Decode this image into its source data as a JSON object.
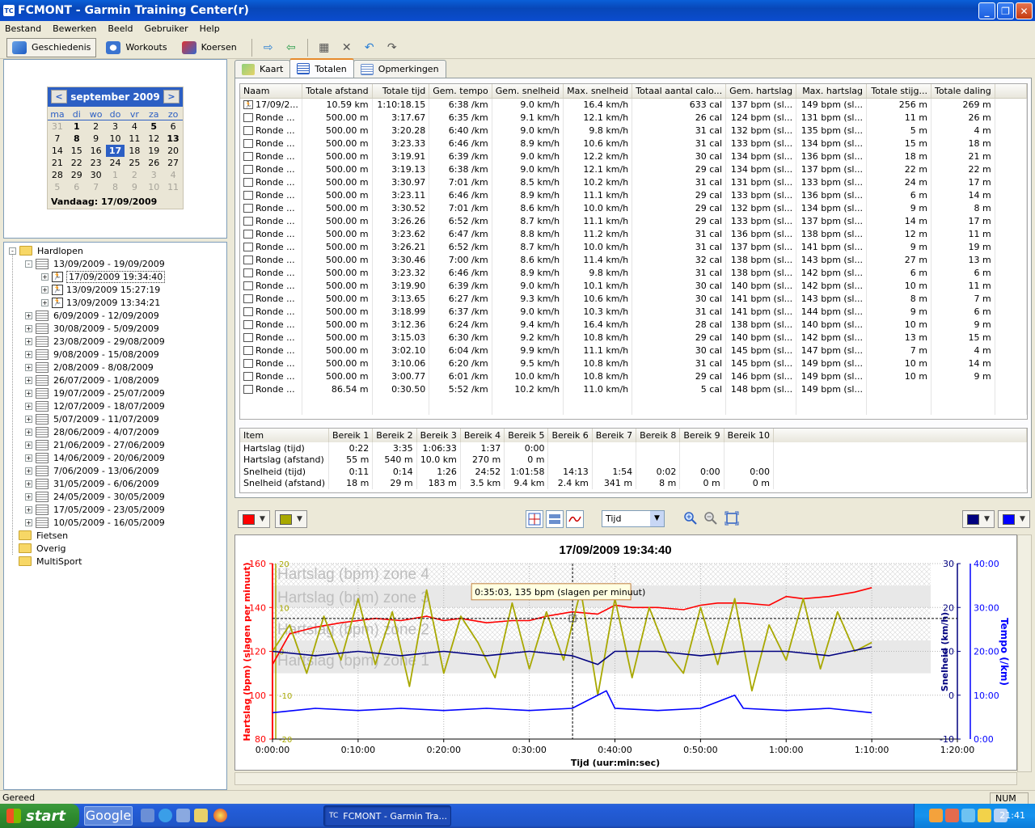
{
  "window": {
    "title": "FCMONT - Garmin Training Center(r)",
    "app_icon": "tc-icon"
  },
  "menu": [
    "Bestand",
    "Bewerken",
    "Beeld",
    "Gebruiker",
    "Help"
  ],
  "toolbar": {
    "geschiedenis": "Geschiedenis",
    "workouts": "Workouts",
    "koersen": "Koersen"
  },
  "calendar": {
    "month": "september 2009",
    "prev": "<",
    "next": ">",
    "dow": [
      "ma",
      "di",
      "wo",
      "do",
      "vr",
      "za",
      "zo"
    ],
    "weeks": [
      [
        {
          "d": "31",
          "o": 1
        },
        {
          "d": "1",
          "b": 1
        },
        {
          "d": "2"
        },
        {
          "d": "3"
        },
        {
          "d": "5",
          "b": 1,
          "_note": "placeholder"
        },
        {
          "d": "5",
          "b": 1
        },
        {
          "d": "6"
        }
      ],
      [
        {
          "d": "7"
        },
        {
          "d": "8",
          "b": 1
        },
        {
          "d": "9"
        },
        {
          "d": "10"
        },
        {
          "d": "11"
        },
        {
          "d": "12"
        },
        {
          "d": "13",
          "b": 1
        }
      ],
      [
        {
          "d": "14"
        },
        {
          "d": "15"
        },
        {
          "d": "16"
        },
        {
          "d": "17",
          "s": 1
        },
        {
          "d": "18"
        },
        {
          "d": "19"
        },
        {
          "d": "20"
        }
      ],
      [
        {
          "d": "21"
        },
        {
          "d": "22"
        },
        {
          "d": "23"
        },
        {
          "d": "24"
        },
        {
          "d": "25"
        },
        {
          "d": "26"
        },
        {
          "d": "27"
        }
      ],
      [
        {
          "d": "28"
        },
        {
          "d": "29"
        },
        {
          "d": "30"
        },
        {
          "d": "1",
          "o": 1
        },
        {
          "d": "2",
          "o": 1
        },
        {
          "d": "3",
          "o": 1
        },
        {
          "d": "4",
          "o": 1
        }
      ],
      [
        {
          "d": "5",
          "o": 1
        },
        {
          "d": "6",
          "o": 1
        },
        {
          "d": "7",
          "o": 1
        },
        {
          "d": "8",
          "o": 1
        },
        {
          "d": "9",
          "o": 1
        },
        {
          "d": "10",
          "o": 1
        },
        {
          "d": "11",
          "o": 1
        }
      ]
    ],
    "today": "Vandaag: 17/09/2009"
  },
  "tree": {
    "root": "Hardlopen",
    "week_open": "13/09/2009 - 19/09/2009",
    "activities": [
      "17/09/2009 19:34:40",
      "13/09/2009 15:27:19",
      "13/09/2009 13:34:21"
    ],
    "weeks": [
      "6/09/2009 - 12/09/2009",
      "30/08/2009 - 5/09/2009",
      "23/08/2009 - 29/08/2009",
      "9/08/2009 - 15/08/2009",
      "2/08/2009 - 8/08/2009",
      "26/07/2009 - 1/08/2009",
      "19/07/2009 - 25/07/2009",
      "12/07/2009 - 18/07/2009",
      "5/07/2009 - 11/07/2009",
      "28/06/2009 - 4/07/2009",
      "21/06/2009 - 27/06/2009",
      "14/06/2009 - 20/06/2009",
      "7/06/2009 - 13/06/2009",
      "31/05/2009 - 6/06/2009",
      "24/05/2009 - 30/05/2009",
      "17/05/2009 - 23/05/2009",
      "10/05/2009 - 16/05/2009"
    ],
    "folders": [
      "Fietsen",
      "Overig",
      "MultiSport"
    ]
  },
  "tabs": [
    "Kaart",
    "Totalen",
    "Opmerkingen"
  ],
  "laps": {
    "headers": [
      "Naam",
      "Totale afstand",
      "Totale tijd",
      "Gem. tempo",
      "Gem. snelheid",
      "Max. snelheid",
      "Totaal aantal calo...",
      "Gem. hartslag",
      "Max. hartslag",
      "Totale stijg...",
      "Totale daling"
    ],
    "rows": [
      [
        "17/09/2...",
        "10.59 km",
        "1:10:18.15",
        "6:38 /km",
        "9.0 km/h",
        "16.4 km/h",
        "633 cal",
        "137 bpm (sl...",
        "149 bpm (sl...",
        "256 m",
        "269 m"
      ],
      [
        "Ronde ...",
        "500.00 m",
        "3:17.67",
        "6:35 /km",
        "9.1 km/h",
        "12.1 km/h",
        "26 cal",
        "124 bpm (sl...",
        "131 bpm (sl...",
        "11 m",
        "26 m"
      ],
      [
        "Ronde ...",
        "500.00 m",
        "3:20.28",
        "6:40 /km",
        "9.0 km/h",
        "9.8 km/h",
        "31 cal",
        "132 bpm (sl...",
        "135 bpm (sl...",
        "5 m",
        "4 m"
      ],
      [
        "Ronde ...",
        "500.00 m",
        "3:23.33",
        "6:46 /km",
        "8.9 km/h",
        "10.6 km/h",
        "31 cal",
        "133 bpm (sl...",
        "134 bpm (sl...",
        "15 m",
        "18 m"
      ],
      [
        "Ronde ...",
        "500.00 m",
        "3:19.91",
        "6:39 /km",
        "9.0 km/h",
        "12.2 km/h",
        "30 cal",
        "134 bpm (sl...",
        "136 bpm (sl...",
        "18 m",
        "21 m"
      ],
      [
        "Ronde ...",
        "500.00 m",
        "3:19.13",
        "6:38 /km",
        "9.0 km/h",
        "12.1 km/h",
        "29 cal",
        "134 bpm (sl...",
        "137 bpm (sl...",
        "22 m",
        "22 m"
      ],
      [
        "Ronde ...",
        "500.00 m",
        "3:30.97",
        "7:01 /km",
        "8.5 km/h",
        "10.2 km/h",
        "31 cal",
        "131 bpm (sl...",
        "133 bpm (sl...",
        "24 m",
        "17 m"
      ],
      [
        "Ronde ...",
        "500.00 m",
        "3:23.11",
        "6:46 /km",
        "8.9 km/h",
        "11.1 km/h",
        "29 cal",
        "133 bpm (sl...",
        "136 bpm (sl...",
        "6 m",
        "14 m"
      ],
      [
        "Ronde ...",
        "500.00 m",
        "3:30.52",
        "7:01 /km",
        "8.6 km/h",
        "10.0 km/h",
        "29 cal",
        "132 bpm (sl...",
        "134 bpm (sl...",
        "9 m",
        "8 m"
      ],
      [
        "Ronde ...",
        "500.00 m",
        "3:26.26",
        "6:52 /km",
        "8.7 km/h",
        "11.1 km/h",
        "29 cal",
        "133 bpm (sl...",
        "137 bpm (sl...",
        "14 m",
        "17 m"
      ],
      [
        "Ronde ...",
        "500.00 m",
        "3:23.62",
        "6:47 /km",
        "8.8 km/h",
        "11.2 km/h",
        "31 cal",
        "136 bpm (sl...",
        "138 bpm (sl...",
        "12 m",
        "11 m"
      ],
      [
        "Ronde ...",
        "500.00 m",
        "3:26.21",
        "6:52 /km",
        "8.7 km/h",
        "10.0 km/h",
        "31 cal",
        "137 bpm (sl...",
        "141 bpm (sl...",
        "9 m",
        "19 m"
      ],
      [
        "Ronde ...",
        "500.00 m",
        "3:30.46",
        "7:00 /km",
        "8.6 km/h",
        "11.4 km/h",
        "32 cal",
        "138 bpm (sl...",
        "143 bpm (sl...",
        "27 m",
        "13 m"
      ],
      [
        "Ronde ...",
        "500.00 m",
        "3:23.32",
        "6:46 /km",
        "8.9 km/h",
        "9.8 km/h",
        "31 cal",
        "138 bpm (sl...",
        "142 bpm (sl...",
        "6 m",
        "6 m"
      ],
      [
        "Ronde ...",
        "500.00 m",
        "3:19.90",
        "6:39 /km",
        "9.0 km/h",
        "10.1 km/h",
        "30 cal",
        "140 bpm (sl...",
        "142 bpm (sl...",
        "10 m",
        "11 m"
      ],
      [
        "Ronde ...",
        "500.00 m",
        "3:13.65",
        "6:27 /km",
        "9.3 km/h",
        "10.6 km/h",
        "30 cal",
        "141 bpm (sl...",
        "143 bpm (sl...",
        "8 m",
        "7 m"
      ],
      [
        "Ronde ...",
        "500.00 m",
        "3:18.99",
        "6:37 /km",
        "9.0 km/h",
        "10.3 km/h",
        "31 cal",
        "141 bpm (sl...",
        "144 bpm (sl...",
        "9 m",
        "6 m"
      ],
      [
        "Ronde ...",
        "500.00 m",
        "3:12.36",
        "6:24 /km",
        "9.4 km/h",
        "16.4 km/h",
        "28 cal",
        "138 bpm (sl...",
        "140 bpm (sl...",
        "10 m",
        "9 m"
      ],
      [
        "Ronde ...",
        "500.00 m",
        "3:15.03",
        "6:30 /km",
        "9.2 km/h",
        "10.8 km/h",
        "29 cal",
        "140 bpm (sl...",
        "142 bpm (sl...",
        "13 m",
        "15 m"
      ],
      [
        "Ronde ...",
        "500.00 m",
        "3:02.10",
        "6:04 /km",
        "9.9 km/h",
        "11.1 km/h",
        "30 cal",
        "145 bpm (sl...",
        "147 bpm (sl...",
        "7 m",
        "4 m"
      ],
      [
        "Ronde ...",
        "500.00 m",
        "3:10.06",
        "6:20 /km",
        "9.5 km/h",
        "10.8 km/h",
        "31 cal",
        "145 bpm (sl...",
        "149 bpm (sl...",
        "10 m",
        "14 m"
      ],
      [
        "Ronde ...",
        "500.00 m",
        "3:00.77",
        "6:01 /km",
        "10.0 km/h",
        "10.8 km/h",
        "29 cal",
        "146 bpm (sl...",
        "149 bpm (sl...",
        "10 m",
        "9 m"
      ],
      [
        "Ronde ...",
        "86.54 m",
        "0:30.50",
        "5:52 /km",
        "10.2 km/h",
        "11.0 km/h",
        "5 cal",
        "148 bpm (sl...",
        "149 bpm (sl...",
        "",
        ""
      ]
    ]
  },
  "zones": {
    "headers": [
      "Item",
      "Bereik 1",
      "Bereik 2",
      "Bereik 3",
      "Bereik 4",
      "Bereik 5",
      "Bereik 6",
      "Bereik 7",
      "Bereik 8",
      "Bereik 9",
      "Bereik 10"
    ],
    "rows": [
      [
        "Hartslag (tijd)",
        "0:22",
        "3:35",
        "1:06:33",
        "1:37",
        "0:00",
        "",
        "",
        "",
        "",
        ""
      ],
      [
        "Hartslag (afstand)",
        "55 m",
        "540 m",
        "10.0 km",
        "270 m",
        "0 m",
        "",
        "",
        "",
        "",
        ""
      ],
      [
        "Snelheid (tijd)",
        "0:11",
        "0:14",
        "1:26",
        "24:52",
        "1:01:58",
        "14:13",
        "1:54",
        "0:02",
        "0:00",
        "0:00"
      ],
      [
        "Snelheid (afstand)",
        "18 m",
        "29 m",
        "183 m",
        "3.5 km",
        "9.4 km",
        "2.4 km",
        "341 m",
        "8 m",
        "0 m",
        "0 m"
      ]
    ]
  },
  "chart_toolbar": {
    "unit": "Tijd",
    "left_colors": [
      "#ff0000",
      "#a8a800"
    ],
    "right_colors": [
      "#00007f",
      "#0000ff"
    ]
  },
  "chart_data": {
    "type": "line",
    "title": "17/09/2009 19:34:40",
    "xlabel": "Tijd (uur:min:sec)",
    "xticks": [
      "0:00:00",
      "0:10:00",
      "0:20:00",
      "0:30:00",
      "0:40:00",
      "0:50:00",
      "1:00:00",
      "1:10:00",
      "1:20:00"
    ],
    "xlim_min": [
      0,
      80
    ],
    "y_hr": {
      "label": "Hartslag (bpm) (slagen per minuut)",
      "ticks": [
        "80",
        "100",
        "120",
        "140",
        "160"
      ],
      "lim": [
        80,
        160
      ],
      "color": "#ff0000"
    },
    "y_elev": {
      "ticks": [
        "-20",
        "-10",
        "0",
        "10",
        "20"
      ],
      "lim": [
        -20,
        20
      ],
      "color": "#a8a800"
    },
    "y_speed": {
      "label": "Snelheid (km/h)",
      "ticks": [
        "-10",
        "0",
        "10",
        "20",
        "30"
      ],
      "lim": [
        -10,
        30
      ],
      "color": "#00007f"
    },
    "y_pace": {
      "label": "Tempo (/km)",
      "ticks": [
        "0:00",
        "10:00",
        "20:00",
        "30:00",
        "40:00"
      ],
      "color": "#0000ff"
    },
    "zones": [
      {
        "label": "Hartslag (bpm) zone 4",
        "from": 150,
        "to": 160
      },
      {
        "label": "Hartslag (bpm) zone 3",
        "from": 140,
        "to": 150
      },
      {
        "label": "Hartslag (bpm) zone 2",
        "from": 125,
        "to": 140
      },
      {
        "label": "Hartslag (bpm) zone 1",
        "from": 110,
        "to": 125
      }
    ],
    "tooltip": "0:35:03, 135 bpm (slagen per minuut)",
    "cursor": {
      "t": 35.05,
      "hr": 135
    },
    "series": [
      {
        "name": "Hartslag",
        "color": "#ff0000",
        "t": [
          0,
          2,
          5,
          8,
          10,
          12,
          15,
          18,
          20,
          22,
          25,
          28,
          30,
          32,
          35,
          38,
          40,
          42,
          45,
          48,
          50,
          52,
          55,
          58,
          60,
          62,
          65,
          68,
          70
        ],
        "v": [
          114,
          128,
          131,
          133,
          134,
          135,
          134,
          136,
          134,
          135,
          133,
          134,
          134,
          136,
          138,
          137,
          141,
          140,
          140,
          139,
          141,
          142,
          142,
          141,
          145,
          144,
          145,
          147,
          149
        ]
      },
      {
        "name": "Hoogte",
        "color": "#a8a800",
        "t": [
          0,
          2,
          4,
          6,
          8,
          10,
          12,
          14,
          16,
          18,
          20,
          22,
          24,
          26,
          28,
          30,
          32,
          34,
          36,
          38,
          40,
          42,
          44,
          46,
          48,
          50,
          52,
          54,
          56,
          58,
          60,
          62,
          64,
          66,
          68,
          70
        ],
        "v": [
          0,
          6,
          -5,
          8,
          -2,
          12,
          -3,
          9,
          -8,
          14,
          -5,
          8,
          2,
          -6,
          11,
          -4,
          9,
          -2,
          14,
          -10,
          12,
          -6,
          10,
          0,
          -5,
          10,
          -3,
          12,
          -9,
          6,
          -2,
          12,
          -4,
          9,
          0,
          2
        ]
      },
      {
        "name": "Snelheid",
        "color": "#00007f",
        "t": [
          0,
          5,
          10,
          15,
          20,
          25,
          30,
          35,
          38,
          40,
          45,
          50,
          55,
          60,
          65,
          70
        ],
        "v": [
          10,
          9,
          10,
          9,
          10,
          9,
          10,
          9,
          7,
          10,
          10,
          9,
          10,
          10,
          9,
          11
        ]
      },
      {
        "name": "Tempo",
        "color": "#0000ff",
        "t": [
          0,
          5,
          10,
          15,
          20,
          25,
          30,
          35,
          39,
          40,
          45,
          50,
          54,
          55,
          60,
          65,
          70
        ],
        "v": [
          -4,
          -3,
          -3.5,
          -3,
          -3.5,
          -3,
          -3.5,
          -3,
          1,
          -3,
          -3.5,
          -3,
          0,
          -3,
          -3.5,
          -3,
          -4
        ]
      }
    ]
  },
  "status": {
    "left": "Gereed",
    "right": "NUM"
  },
  "taskbar": {
    "start": "start",
    "google": "Google",
    "task": "FCMONT - Garmin Tra...",
    "clock": "21:41"
  }
}
